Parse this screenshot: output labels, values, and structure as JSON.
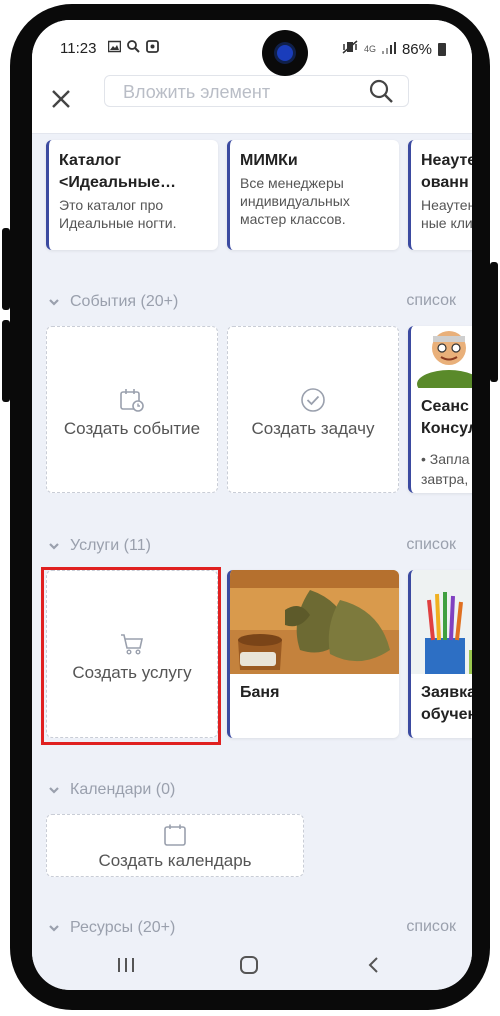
{
  "status_bar": {
    "time": "11:23",
    "network": "4G",
    "battery": "86%"
  },
  "top_bar": {
    "search_placeholder": "Вложить элемент"
  },
  "catalog_cards": [
    {
      "title": "Каталог",
      "title2": "<Идеальные…",
      "desc": "Это каталог про Идеальные ногти."
    },
    {
      "title": "МИМКи",
      "title2": "",
      "desc": "Все менеджеры индивидуальных мастер классов."
    },
    {
      "title": "Неауте",
      "title2": "ованн",
      "desc": "Неаутен ные кли"
    }
  ],
  "sections": {
    "events": {
      "title": "События (20+)",
      "list_label": "список"
    },
    "services": {
      "title": "Услуги (11)",
      "list_label": "список"
    },
    "calendars": {
      "title": "Календари (0)"
    },
    "resources": {
      "title": "Ресурсы (20+)",
      "list_label": "список"
    }
  },
  "events": {
    "create_event": "Создать событие",
    "create_task": "Создать задачу",
    "card_title1": "Сеанс",
    "card_title2": "Консул",
    "card_desc1": "• Запла",
    "card_desc2": "завтра,"
  },
  "services": {
    "create_service": "Создать услугу",
    "card1_title": "Баня",
    "card2_title1": "Заявка",
    "card2_title2": "обучен"
  },
  "calendars": {
    "create_calendar": "Создать календарь"
  },
  "colors": {
    "accent": "#3b4aa0",
    "highlight": "#e02020",
    "background": "#eef1f8"
  }
}
